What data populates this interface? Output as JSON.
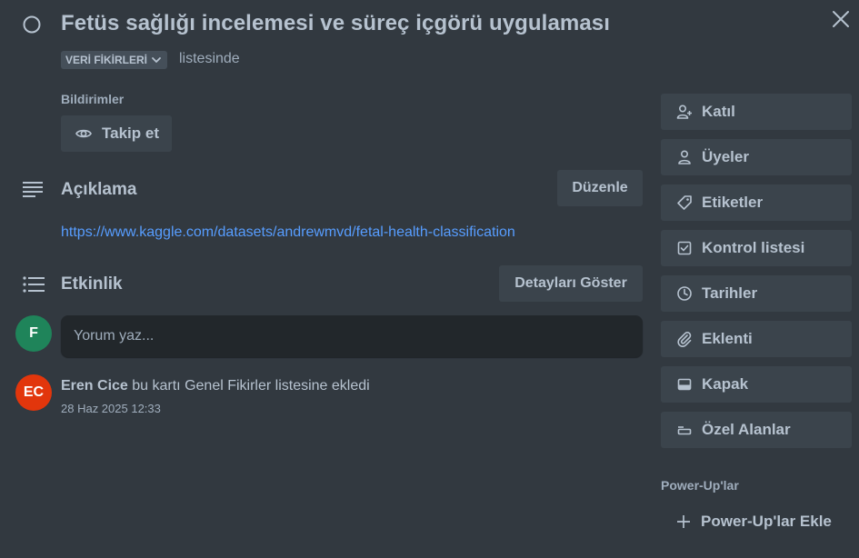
{
  "card": {
    "title": "Fetüs sağlığı incelemesi ve süreç içgörü uygulaması",
    "list_name": "VERİ FİKİRLERİ",
    "list_suffix": "listesinde"
  },
  "notifications": {
    "label": "Bildirimler",
    "follow_label": "Takip et"
  },
  "description": {
    "heading": "Açıklama",
    "edit_label": "Düzenle",
    "link": "https://www.kaggle.com/datasets/andrewmvd/fetal-health-classification"
  },
  "activity": {
    "heading": "Etkinlik",
    "details_label": "Detayları Göster",
    "current_user_initial": "F",
    "comment_placeholder": "Yorum yaz...",
    "entries": [
      {
        "initials": "EC",
        "user": "Eren Cice",
        "text": "bu kartı Genel Fikirler listesine ekledi",
        "time": "28 Haz 2025 12:33"
      }
    ]
  },
  "sidebar": {
    "items": [
      {
        "label": "Katıl",
        "icon": "add-member-icon"
      },
      {
        "label": "Üyeler",
        "icon": "member-icon"
      },
      {
        "label": "Etiketler",
        "icon": "label-icon"
      },
      {
        "label": "Kontrol listesi",
        "icon": "checklist-icon"
      },
      {
        "label": "Tarihler",
        "icon": "clock-icon"
      },
      {
        "label": "Eklenti",
        "icon": "attachment-icon"
      },
      {
        "label": "Kapak",
        "icon": "cover-icon"
      },
      {
        "label": "Özel Alanlar",
        "icon": "custom-fields-icon"
      }
    ],
    "powerups_label": "Power-Up'lar",
    "add_powerups_label": "Power-Up'lar Ekle"
  },
  "colors": {
    "background": "#323940",
    "button": "#3b444c",
    "link": "#579dff",
    "avatar_f": "#1f845a",
    "avatar_ec": "#e2360c"
  }
}
